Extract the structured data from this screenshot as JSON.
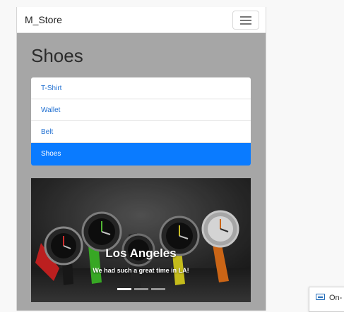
{
  "navbar": {
    "brand": "M_Store",
    "menu_icon": "hamburger-icon"
  },
  "page": {
    "heading": "Shoes"
  },
  "categories": [
    {
      "label": "T-Shirt",
      "active": false
    },
    {
      "label": "Wallet",
      "active": false
    },
    {
      "label": "Belt",
      "active": false
    },
    {
      "label": "Shoes",
      "active": true
    }
  ],
  "carousel": {
    "title": "Los Angeles",
    "text": "We had such a great time in LA!",
    "slide_count": 3,
    "active_index": 0
  },
  "taskbar": {
    "osk_label": "On-",
    "osk_icon": "keyboard-icon"
  },
  "colors": {
    "accent": "#0a7bff",
    "link": "#1f6fd1",
    "page_bg": "#a6a6a6"
  }
}
